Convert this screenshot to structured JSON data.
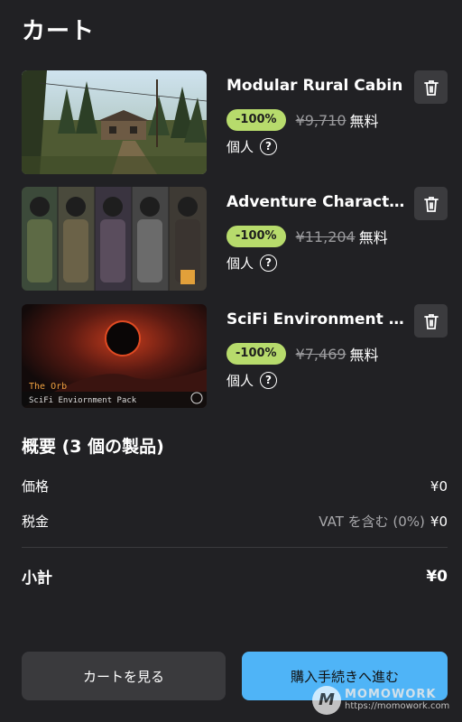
{
  "header": {
    "title": "カート"
  },
  "items": [
    {
      "name": "Modular Rural Cabin",
      "discount": "-100%",
      "original_price": "¥9,710",
      "price": "無料",
      "license": "個人",
      "remove_icon": "trash-icon"
    },
    {
      "name": "Adventure Character...",
      "discount": "-100%",
      "original_price": "¥11,204",
      "price": "無料",
      "license": "個人",
      "remove_icon": "trash-icon"
    },
    {
      "name": "SciFi Environment — ...",
      "discount": "-100%",
      "original_price": "¥7,469",
      "price": "無料",
      "license": "個人",
      "remove_icon": "trash-icon",
      "thumb_title": "The Orb",
      "thumb_subtitle": "SciFi Enviornment Pack"
    }
  ],
  "summary": {
    "title": "概要 (3 個の製品)",
    "price_label": "価格",
    "price_value": "¥0",
    "tax_label": "税金",
    "tax_note": "VAT を含む (0%)",
    "tax_value": "¥0",
    "subtotal_label": "小計",
    "subtotal_value": "¥0"
  },
  "actions": {
    "view_cart": "カートを見る",
    "checkout": "購入手続きへ進む"
  },
  "watermark": {
    "brand": "MOMOWORK",
    "url": "https://momowork.com",
    "logo": "M"
  },
  "colors": {
    "background": "#212124",
    "discount_badge": "#b7db6c",
    "checkout_button": "#4fb4f7",
    "secondary_button": "#3a3a3d"
  }
}
